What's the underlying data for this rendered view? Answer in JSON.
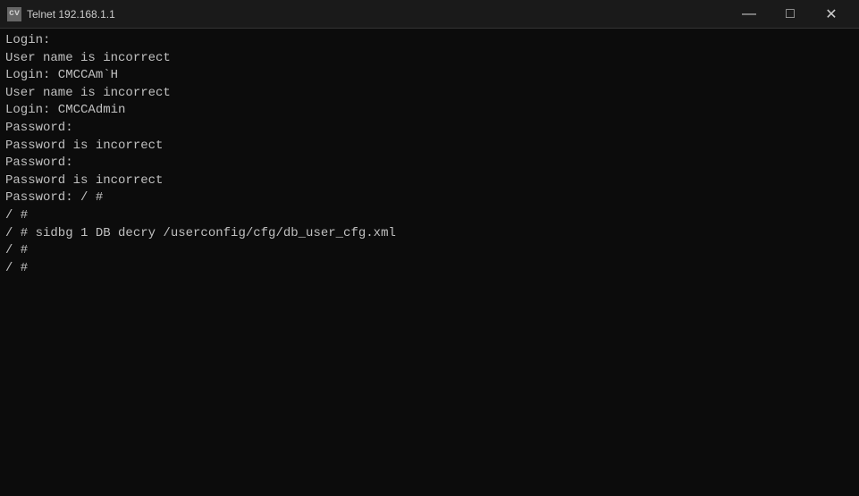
{
  "titlebar": {
    "icon_label": "cv",
    "title": "Telnet 192.168.1.1",
    "minimize_label": "—",
    "maximize_label": "□",
    "close_label": "✕"
  },
  "terminal": {
    "content": "Login:\nUser name is incorrect\nLogin: CMCCAm`H\nUser name is incorrect\nLogin: CMCCAdmin\nPassword:\nPassword is incorrect\nPassword:\nPassword is incorrect\nPassword: / #\n/ #\n/ # sidbg 1 DB decry /userconfig/cfg/db_user_cfg.xml\n/ #\n/ #"
  }
}
